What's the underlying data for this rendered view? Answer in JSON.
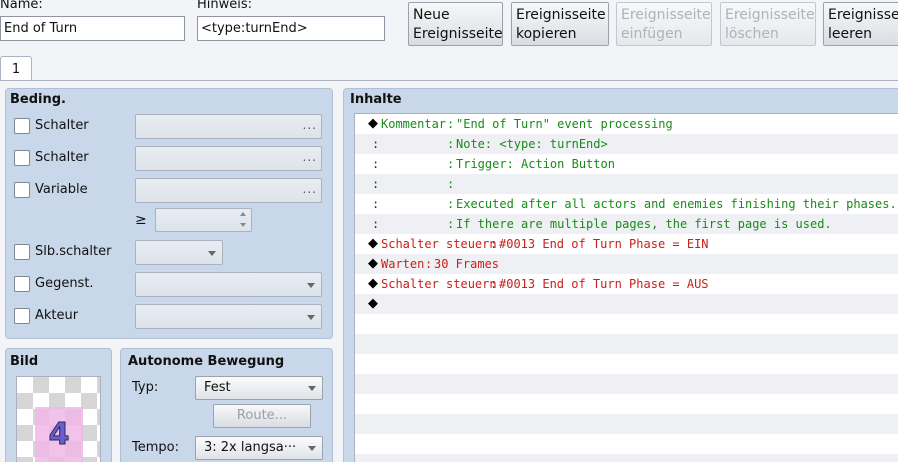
{
  "header": {
    "name_label": "Name:",
    "name_value": "End of Turn",
    "hint_label": "Hinweis:",
    "hint_value": "<type:turnEnd>",
    "buttons": [
      {
        "line1": "Neue",
        "line2": "Ereignisseite",
        "enabled": true
      },
      {
        "line1": "Ereignisseite",
        "line2": "kopieren",
        "enabled": true
      },
      {
        "line1": "Ereignisseite",
        "line2": "einfügen",
        "enabled": false
      },
      {
        "line1": "Ereignisseite",
        "line2": "löschen",
        "enabled": false
      },
      {
        "line1": "Ereignisseite",
        "line2": "leeren",
        "enabled": true
      }
    ]
  },
  "tabs": [
    {
      "label": "1"
    }
  ],
  "conditions": {
    "title": "Beding.",
    "rows": [
      {
        "label": "Schalter",
        "control": "picker",
        "icon": "ellipsis-icon",
        "ellipsis": "..."
      },
      {
        "label": "Schalter",
        "control": "picker",
        "icon": "ellipsis-icon",
        "ellipsis": "..."
      },
      {
        "label": "Variable",
        "control": "picker",
        "icon": "ellipsis-icon",
        "ellipsis": "..."
      },
      {
        "label": "Slb.schalter",
        "control": "dropdown",
        "icon": "chevron-down-icon"
      },
      {
        "label": "Gegenst.",
        "control": "dropdown",
        "icon": "chevron-down-icon"
      },
      {
        "label": "Akteur",
        "control": "dropdown",
        "icon": "chevron-down-icon"
      }
    ],
    "compare_symbol": "≥"
  },
  "image": {
    "title": "Bild",
    "glyph": "4"
  },
  "autonomous": {
    "title": "Autonome Bewegung",
    "type_label": "Typ:",
    "type_value": "Fest",
    "route_label": "Route...",
    "speed_label": "Tempo:",
    "speed_value": "3: 2x langsa···"
  },
  "contents": {
    "title": "Inhalte",
    "rows": [
      {
        "marker": "◆",
        "cmd": "Kommentar",
        "sep": ":",
        "text": "\"End of Turn\" event processing",
        "color": "green"
      },
      {
        "marker": ":",
        "cmd": "",
        "sep": ":",
        "text": "Note: <type: turnEnd>",
        "color": "green"
      },
      {
        "marker": ":",
        "cmd": "",
        "sep": ":",
        "text": "Trigger: Action Button",
        "color": "green"
      },
      {
        "marker": ":",
        "cmd": "",
        "sep": ":",
        "text": "",
        "color": "green"
      },
      {
        "marker": ":",
        "cmd": "",
        "sep": ":",
        "text": "Executed after all actors and enemies finishing their phases.",
        "color": "green"
      },
      {
        "marker": ":",
        "cmd": "",
        "sep": ":",
        "text": "If there are multiple pages, the first page is used.",
        "color": "green"
      },
      {
        "marker": "◆",
        "cmd": "Schalter steuern",
        "sep": ":",
        "text": "#0013 End of Turn Phase = EIN",
        "color": "red"
      },
      {
        "marker": "◆",
        "cmd": "Warten",
        "sep": ":",
        "text": "30 Frames",
        "color": "red"
      },
      {
        "marker": "◆",
        "cmd": "Schalter steuern",
        "sep": ":",
        "text": "#0013 End of Turn Phase = AUS",
        "color": "red"
      },
      {
        "marker": "◆",
        "cmd": "",
        "sep": "",
        "text": "",
        "color": "red"
      }
    ]
  },
  "colors": {
    "panel_bg": "#c9d7ea",
    "comment_green": "#1a8a1a",
    "command_red": "#c8201c"
  }
}
